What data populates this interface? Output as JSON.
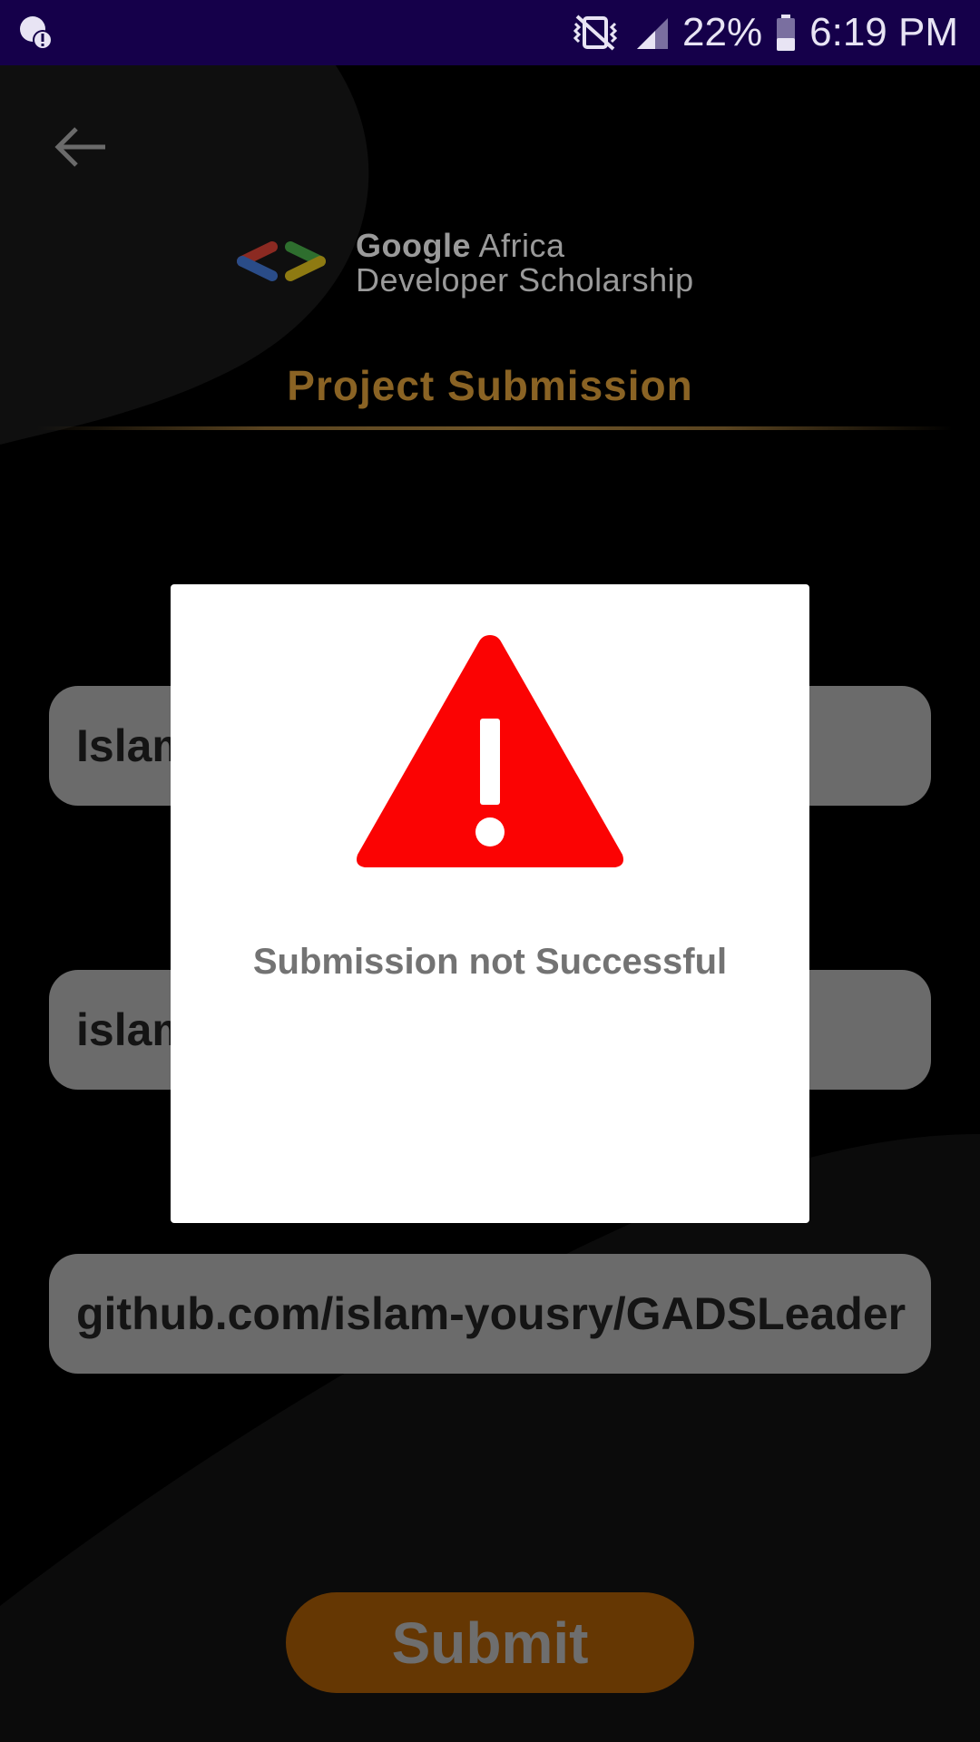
{
  "status_bar": {
    "battery": "22%",
    "time": "6:19 PM",
    "icons": [
      "notification-alert-icon",
      "vibrate-icon",
      "signal-icon",
      "battery-icon"
    ]
  },
  "header": {
    "back_icon": "back-arrow-icon",
    "logo_icon": "code-brackets-logo-icon",
    "brand_google": "Google",
    "brand_africa": " Africa",
    "brand_line2": "Developer Scholarship",
    "title": "Project Submission"
  },
  "form": {
    "name_value": "Islam",
    "email_value": "islam",
    "github_value": "github.com/islam-yousry/GADSLeaderboard",
    "submit_label": "Submit"
  },
  "dialog": {
    "icon": "warning-icon",
    "message": "Submission not Successful"
  },
  "colors": {
    "status_bar": "#15004a",
    "dialog_bg": "#ffffff",
    "warning": "#fb0303",
    "accent": "#8a6324",
    "submit_bg": "#653703",
    "field_bg": "#6b6b6b"
  }
}
